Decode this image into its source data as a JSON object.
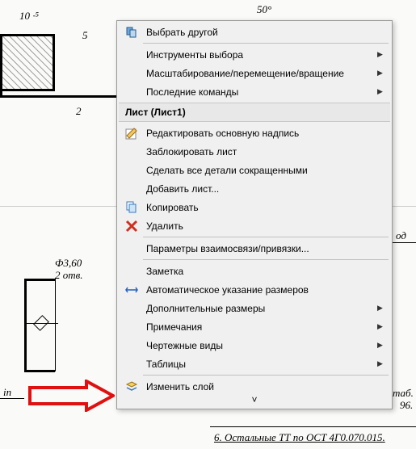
{
  "drawing": {
    "dim1": "10 ·⁵",
    "dim2": "5",
    "dim3": "50°",
    "dim4": "2",
    "dim5": "Ф3,60",
    "dim6": "2 отв.",
    "label_in": "in",
    "note1": "таб.",
    "note2": "96.",
    "note3": "6. Остальные ТТ по ОСТ 4Г0.070.015.",
    "note4": "од"
  },
  "menu": {
    "select_other": "Выбрать другой",
    "selection_tools": "Инструменты выбора",
    "zoom_pan_rotate": "Масштабирование/перемещение/вращение",
    "recent_commands": "Последние команды",
    "header": "Лист (Лист1)",
    "edit_title_block": "Редактировать основную надпись",
    "lock_sheet": "Заблокировать лист",
    "make_shortened": "Сделать все детали сокращенными",
    "add_sheet": "Добавить лист...",
    "copy": "Копировать",
    "delete": "Удалить",
    "relation_params": "Параметры взаимосвязи/привязки...",
    "note": "Заметка",
    "auto_dimensions": "Автоматическое указание размеров",
    "more_dimensions": "Дополнительные размеры",
    "annotations": "Примечания",
    "drawing_views": "Чертежные виды",
    "tables": "Таблицы",
    "change_layer": "Изменить слой",
    "chevron": "˅"
  }
}
